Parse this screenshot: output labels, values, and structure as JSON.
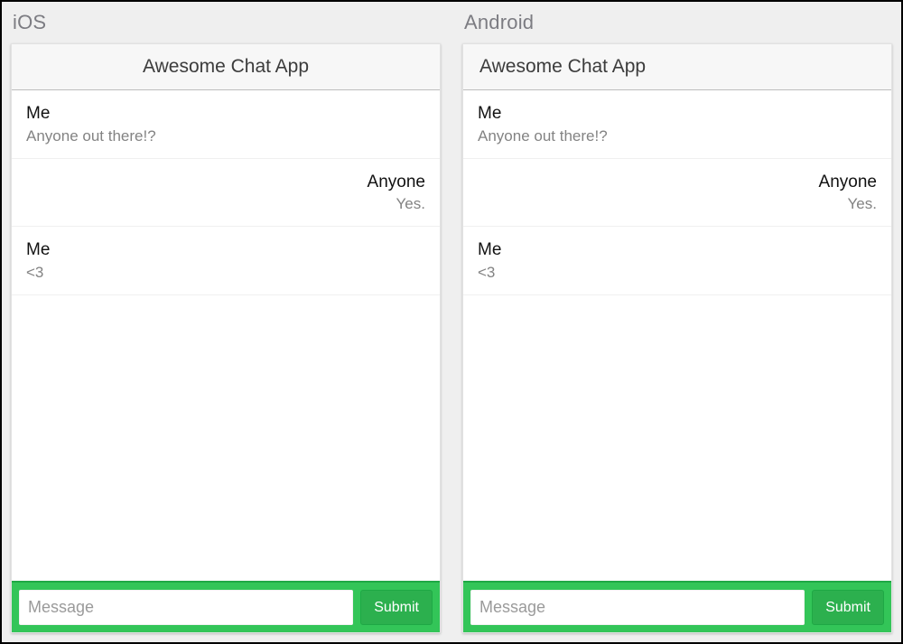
{
  "ios": {
    "platform_label": "iOS",
    "app_title": "Awesome Chat App",
    "messages": [
      {
        "sender": "Me",
        "text": "Anyone out there!?",
        "align": "left"
      },
      {
        "sender": "Anyone",
        "text": "Yes.",
        "align": "right"
      },
      {
        "sender": "Me",
        "text": "<3",
        "align": "left"
      }
    ],
    "composer": {
      "placeholder": "Message",
      "submit_label": "Submit"
    }
  },
  "android": {
    "platform_label": "Android",
    "app_title": "Awesome Chat App",
    "messages": [
      {
        "sender": "Me",
        "text": "Anyone out there!?",
        "align": "left"
      },
      {
        "sender": "Anyone",
        "text": "Yes.",
        "align": "right"
      },
      {
        "sender": "Me",
        "text": "<3",
        "align": "left"
      }
    ],
    "composer": {
      "placeholder": "Message",
      "submit_label": "Submit"
    }
  },
  "colors": {
    "accent_green": "#33c558",
    "accent_green_dark": "#1fa845"
  }
}
